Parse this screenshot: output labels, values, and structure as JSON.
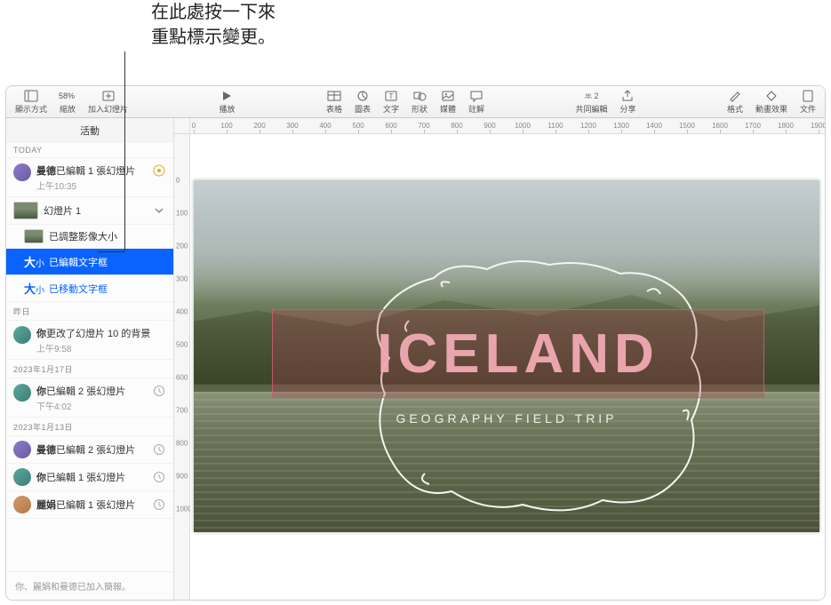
{
  "callout": {
    "text": "在此處按一下來\n重點標示變更。"
  },
  "toolbar": {
    "view": "顯示方式",
    "zoom_value": "58%",
    "zoom_label": "縮放",
    "add_slide": "加入幻燈片",
    "play": "播放",
    "table": "表格",
    "chart": "圖表",
    "text": "文字",
    "shape": "形狀",
    "media": "媒體",
    "comment": "註解",
    "collab": "共同編輯",
    "collab_count": "2",
    "share": "分享",
    "format": "格式",
    "animate": "動畫效果",
    "document": "文件"
  },
  "sidebar": {
    "title": "活動",
    "today": "TODAY",
    "entry1_user": "曼德",
    "entry1_action": "已編輯 1 張幻燈片",
    "entry1_time": "上午10:35",
    "slide_header": "幻燈片 1",
    "child_resize": "已調整影像大小",
    "child_edit_text": "已編輯文字框",
    "child_move_text": "已移動文字框",
    "yesterday": "昨日",
    "entry2_user": "你",
    "entry2_action": "更改了幻燈片 10 的背景",
    "entry2_time": "上午9:58",
    "date1": "2023年1月17日",
    "entry3_user": "你",
    "entry3_action": "已編輯 2 張幻燈片",
    "entry3_time": "下午4:02",
    "date2": "2023年1月13日",
    "entry4_user": "曼德",
    "entry4_action": "已編輯 2 張幻燈片",
    "entry5_user": "你",
    "entry5_action": "已編輯 1 張幻燈片",
    "entry6_user": "麗娟",
    "entry6_action": "已編輯 1 張幻燈片",
    "footer": "你、麗娟和曼德已加入簡報。"
  },
  "slide": {
    "title": "ICELAND",
    "subtitle": "GEOGRAPHY FIELD TRIP"
  },
  "ruler_h": [
    "0",
    "100",
    "200",
    "300",
    "400",
    "500",
    "600",
    "700",
    "800",
    "900",
    "1000",
    "1100",
    "1200",
    "1300",
    "1400",
    "1500",
    "1600",
    "1700",
    "1800",
    "1900"
  ],
  "ruler_v": [
    "0",
    "100",
    "200",
    "300",
    "400",
    "500",
    "600",
    "700",
    "800",
    "900",
    "1000"
  ]
}
